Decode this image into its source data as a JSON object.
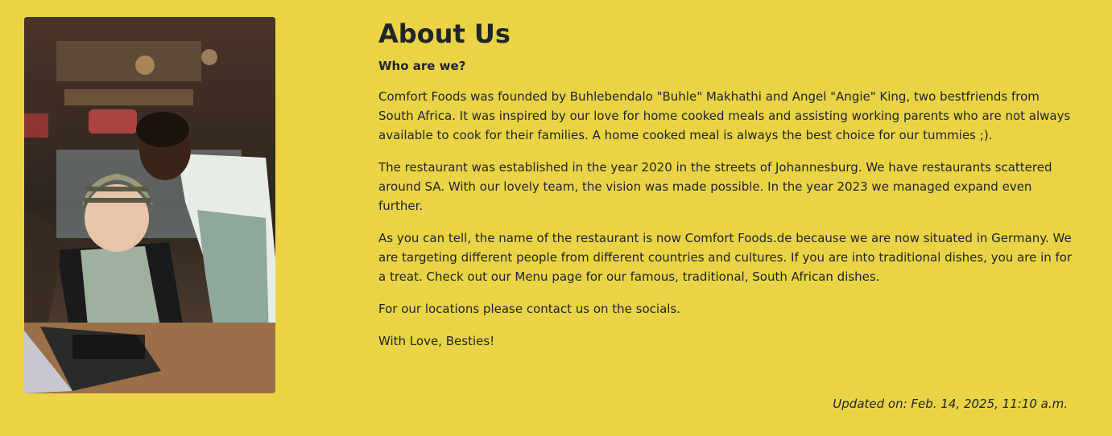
{
  "about": {
    "title": "About Us",
    "subtitle": "Who are we?",
    "paragraphs": [
      "Comfort Foods was founded by Buhlebendalo \"Buhle\" Makhathi and Angel \"Angie\" King, two bestfriends from South Africa. It was inspired by our love for home cooked meals and assisting working parents who are not always available to cook for their families. A home cooked meal is always the best choice for our tummies ;).",
      "The restaurant was established in the year 2020 in the streets of Johannesburg. We have restaurants scattered around SA. With our lovely team, the vision was made possible. In the year 2023 we managed expand even further.",
      "As you can tell, the name of the restaurant is now Comfort Foods.de because we are now situated in Germany. We are targeting different people from different countries and cultures. If you are into traditional dishes, you are in for a treat. Check out our Menu page for our famous, traditional, South African dishes.",
      "For our locations please contact us on the socials.",
      "With Love, Besties!"
    ],
    "updated": "Updated on: Feb. 14, 2025, 11:10 a.m."
  },
  "colors": {
    "background": "#ead446",
    "text": "#212529"
  }
}
